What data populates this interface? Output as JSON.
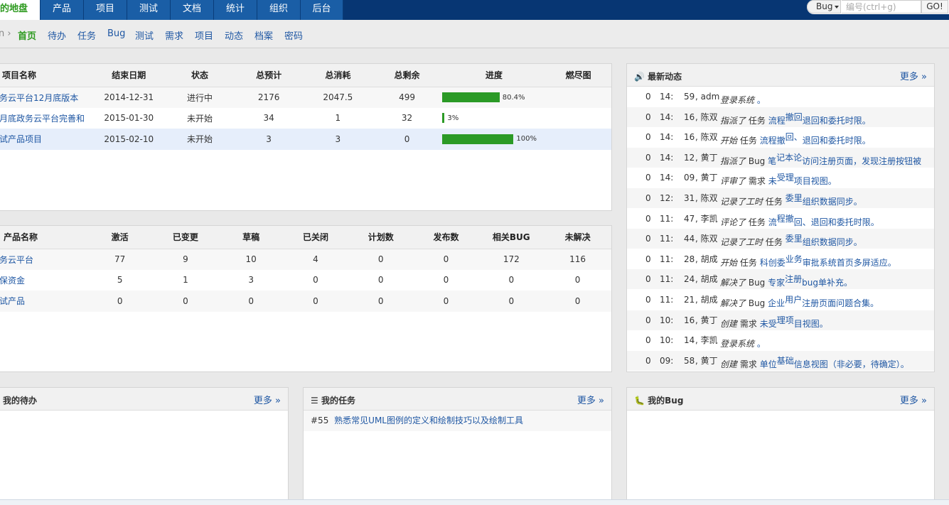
{
  "topnav": {
    "tabs": [
      "的地盘",
      "产品",
      "项目",
      "测试",
      "文档",
      "统计",
      "组织",
      "后台"
    ],
    "search_type": "Bug",
    "search_placeholder": "编号(ctrl+g)",
    "go_label": "GO!"
  },
  "subnav": {
    "crumb": "n ›",
    "items": [
      "首页",
      "待办",
      "任务",
      "Bug",
      "测试",
      "需求",
      "项目",
      "动态",
      "档案",
      "密码"
    ]
  },
  "projects": {
    "headers": [
      "项目名称",
      "结束日期",
      "状态",
      "总预计",
      "总消耗",
      "总剩余",
      "进度",
      "燃尽图"
    ],
    "rows": [
      {
        "name": "务云平台12月底版本",
        "end": "2014-12-31",
        "status": "进行中",
        "est": "2176",
        "consumed": "2047.5",
        "left": "499",
        "progress": 80.4,
        "progress_label": "80.4%"
      },
      {
        "name": "月底政务云平台完善和",
        "end": "2015-01-30",
        "status": "未开始",
        "est": "34",
        "consumed": "1",
        "left": "32",
        "progress": 3,
        "progress_label": "3%"
      },
      {
        "name": "试产品项目",
        "end": "2015-02-10",
        "status": "未开始",
        "est": "3",
        "consumed": "3",
        "left": "0",
        "progress": 100,
        "progress_label": "100%"
      }
    ]
  },
  "products": {
    "headers": [
      "产品名称",
      "激活",
      "已变更",
      "草稿",
      "已关闭",
      "计划数",
      "发布数",
      "相关BUG",
      "未解决"
    ],
    "rows": [
      {
        "name": "务云平台",
        "cells": [
          "77",
          "9",
          "10",
          "4",
          "0",
          "0",
          "172",
          "116"
        ]
      },
      {
        "name": "保资金",
        "cells": [
          "5",
          "1",
          "3",
          "0",
          "0",
          "0",
          "0",
          "0"
        ]
      },
      {
        "name": "试产品",
        "cells": [
          "0",
          "0",
          "0",
          "0",
          "0",
          "0",
          "0",
          "0"
        ]
      }
    ]
  },
  "dynamics": {
    "title": "最新动态",
    "more": "更多",
    "rows": [
      {
        "date": "0",
        "time": "14:",
        "sec": "59",
        "actor": ", adm",
        "action": "登录系统",
        "object": "",
        "tag": "",
        "target": "。"
      },
      {
        "date": "0",
        "time": "14:",
        "sec": "16",
        "actor": ", 陈双",
        "action": "指派了",
        "object": "任务",
        "tag": "撤回",
        "target": "流程",
        "tail": "退回和委托时限。"
      },
      {
        "date": "0",
        "time": "14:",
        "sec": "16",
        "actor": ", 陈双",
        "action": "开始",
        "object": "任务",
        "tag": "回、",
        "target": "流程撤",
        "tail": "退回和委托时限。"
      },
      {
        "date": "0",
        "time": "14:",
        "sec": "12",
        "actor": ", 黄丁",
        "action": "指派了",
        "object": "Bug",
        "tag": "记本论",
        "target": "笔",
        "tail": "访问注册页面，发现注册按钮被"
      },
      {
        "date": "0",
        "time": "14:",
        "sec": "09",
        "actor": ", 黄丁",
        "action": "评审了",
        "object": "需求",
        "tag": "受理",
        "target": "未",
        "tail": "项目视图。"
      },
      {
        "date": "0",
        "time": "12:",
        "sec": "31",
        "actor": ", 陈双",
        "action": "记录了工时",
        "object": "任务",
        "tag": "委里",
        "target": "",
        "tail": "组织数据同步。"
      },
      {
        "date": "0",
        "time": "11:",
        "sec": "47",
        "actor": ", 李凯",
        "action": "评论了",
        "object": "任务",
        "tag": "程撤",
        "target": "流",
        "tail": "回、退回和委托时限。"
      },
      {
        "date": "0",
        "time": "11:",
        "sec": "44",
        "actor": ", 陈双",
        "action": "记录了工时",
        "object": "任务",
        "tag": "委里",
        "target": "",
        "tail": "组织数据同步。"
      },
      {
        "date": "0",
        "time": "11:",
        "sec": "28",
        "actor": ", 胡成",
        "action": "开始",
        "object": "任务",
        "tag": "业务",
        "target": "科创委",
        "tail": "审批系统首页多屏适应。"
      },
      {
        "date": "0",
        "time": "11:",
        "sec": "24",
        "actor": ", 胡成",
        "action": "解决了",
        "object": "Bug",
        "tag": "注册",
        "target": "专家",
        "tail": "bug单补充。"
      },
      {
        "date": "0",
        "time": "11:",
        "sec": "21",
        "actor": ", 胡成",
        "action": "解决了",
        "object": "Bug",
        "tag": "用户",
        "target": "企业",
        "tail": "注册页面问题合集。"
      },
      {
        "date": "0",
        "time": "10:",
        "sec": "16",
        "actor": ", 黄丁",
        "action": "创建",
        "object": "需求",
        "tag": "理项",
        "target": "未受",
        "tail": "目视图。"
      },
      {
        "date": "0",
        "time": "10:",
        "sec": "14",
        "actor": ", 李凯",
        "action": "登录系统",
        "object": "",
        "tag": "",
        "target": "。"
      },
      {
        "date": "0",
        "time": "09:",
        "sec": "58",
        "actor": ", 黄丁",
        "action": "创建",
        "object": "需求",
        "tag": "基础",
        "target": "单位",
        "tail": "信息视图（非必要，待确定）。"
      }
    ]
  },
  "todo": {
    "title": "我的待办",
    "more": "更多"
  },
  "tasks": {
    "title": "我的任务",
    "more": "更多",
    "items": [
      {
        "id": "#55",
        "name": "熟悉常见UML图例的定义和绘制技巧以及绘制工具"
      }
    ]
  },
  "bugs": {
    "title": "我的Bug",
    "more": "更多"
  },
  "colors": {
    "topbar": "#073673",
    "tab": "#1a5ea6",
    "active_green": "#2d9a1f",
    "progress": "#2b9a26",
    "link": "#1f57a3"
  }
}
